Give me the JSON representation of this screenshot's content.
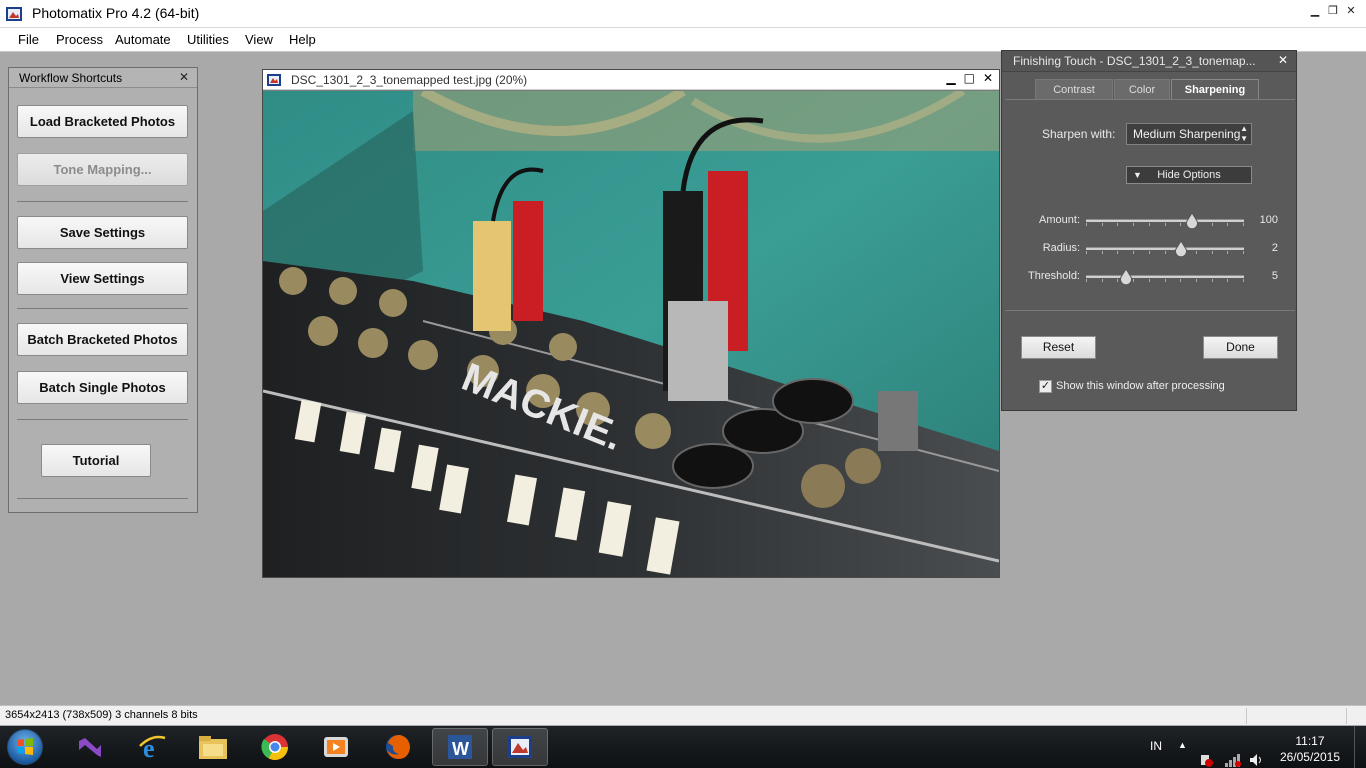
{
  "app": {
    "title": "Photomatix Pro 4.2 (64-bit)"
  },
  "menu": [
    "File",
    "Process",
    "Automate",
    "Utilities",
    "View",
    "Help"
  ],
  "workflow": {
    "title": "Workflow Shortcuts",
    "buttons": {
      "load": "Load Bracketed Photos",
      "tone": "Tone Mapping...",
      "save": "Save Settings",
      "view": "View Settings",
      "batch_bracketed": "Batch Bracketed Photos",
      "batch_single": "Batch Single Photos",
      "tutorial": "Tutorial"
    }
  },
  "image_window": {
    "title": "DSC_1301_2_3_tonemapped test.jpg (20%)"
  },
  "finishing": {
    "title": "Finishing Touch - DSC_1301_2_3_tonemap...",
    "tabs": [
      "Contrast",
      "Color",
      "Sharpening"
    ],
    "active_tab": "Sharpening",
    "sharpen_label": "Sharpen with:",
    "sharpen_value": "Medium Sharpening",
    "hide_options": "Hide Options",
    "sliders": [
      {
        "label": "Amount:",
        "value": "100",
        "fraction": 0.67
      },
      {
        "label": "Radius:",
        "value": "2",
        "fraction": 0.6
      },
      {
        "label": "Threshold:",
        "value": "5",
        "fraction": 0.25
      }
    ],
    "reset": "Reset",
    "done": "Done",
    "show_after": "Show this window after processing",
    "show_after_checked": true
  },
  "status": {
    "text": "3654x2413 (738x509) 3 channels 8 bits"
  },
  "taskbar": {
    "apps": [
      "visual-studio-icon",
      "internet-explorer-icon",
      "file-explorer-icon",
      "chrome-icon",
      "media-player-icon",
      "firefox-icon",
      "word-icon",
      "photomatix-icon"
    ],
    "lang": "IN",
    "time": "11:17",
    "date": "26/05/2015"
  },
  "colors": {
    "panel_dark": "#5a5a5a",
    "workspace": "#a9a9a9",
    "taskbar": "#1a1d20"
  }
}
